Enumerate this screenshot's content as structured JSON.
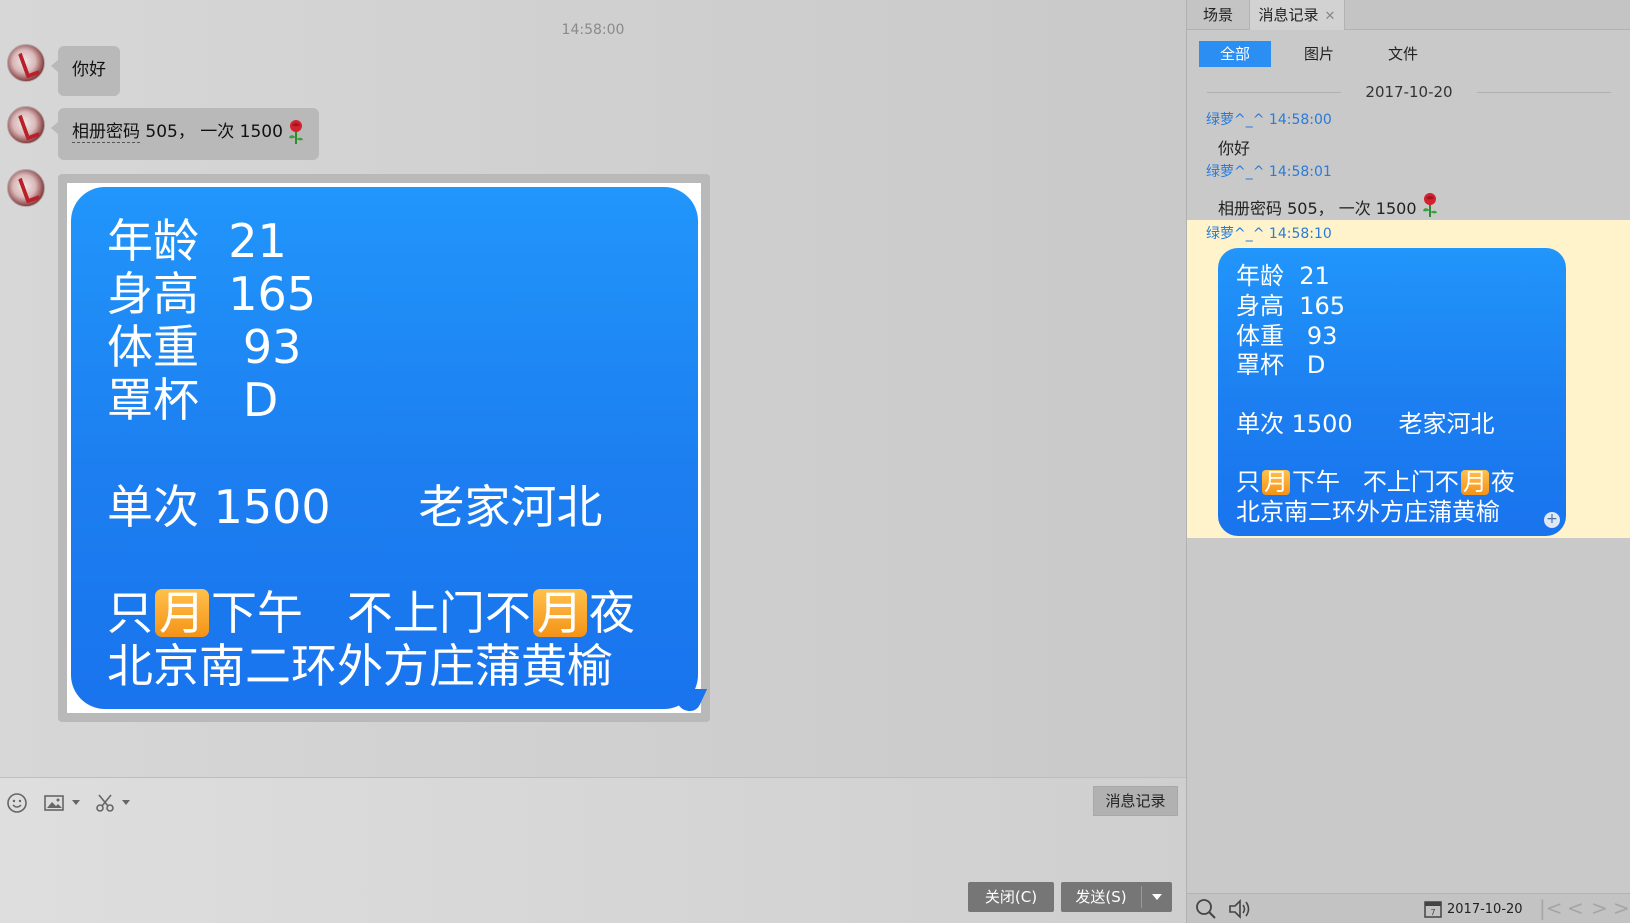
{
  "chat": {
    "timestamp": "14:58:00",
    "messages": [
      {
        "text": "你好"
      },
      {
        "text_a": "相册密码",
        "text_b": " 505， 一次 1500"
      }
    ],
    "image_message": {
      "lines": [
        "年龄  21",
        "身高  165",
        "体重   93",
        "罩杯   D",
        "单次 1500      老家河北"
      ],
      "line6_a": "只",
      "line6_moon1": "月",
      "line6_b": "下午   不上门不",
      "line6_moon2": "月",
      "line6_c": "夜",
      "line7": "北京南二环外方庄蒲黄榆"
    }
  },
  "toolbar": {
    "emoji_icon": "smile-icon",
    "image_icon": "image-icon",
    "screenshot_icon": "scissors-icon",
    "history_button": "消息记录"
  },
  "actions": {
    "close_label": "关闭(C)",
    "send_label": "发送(S)"
  },
  "history": {
    "tabs": [
      {
        "label": "场景"
      },
      {
        "label": "消息记录"
      }
    ],
    "filters": [
      "全部",
      "图片",
      "文件"
    ],
    "date": "2017-10-20",
    "entries": [
      {
        "meta": "绿萝^_^ 14:58:00",
        "text": "你好"
      },
      {
        "meta": "绿萝^_^ 14:58:01",
        "text": "相册密码 505， 一次 1500"
      },
      {
        "meta": "绿萝^_^ 14:58:10"
      }
    ],
    "bottom_date": "2017-10-20"
  },
  "colors": {
    "bubble_blue": "#1c7ef0",
    "accent_blue": "#2b8ef3",
    "highlight": "#fff3cc",
    "meta_blue": "#2a7bd8"
  }
}
